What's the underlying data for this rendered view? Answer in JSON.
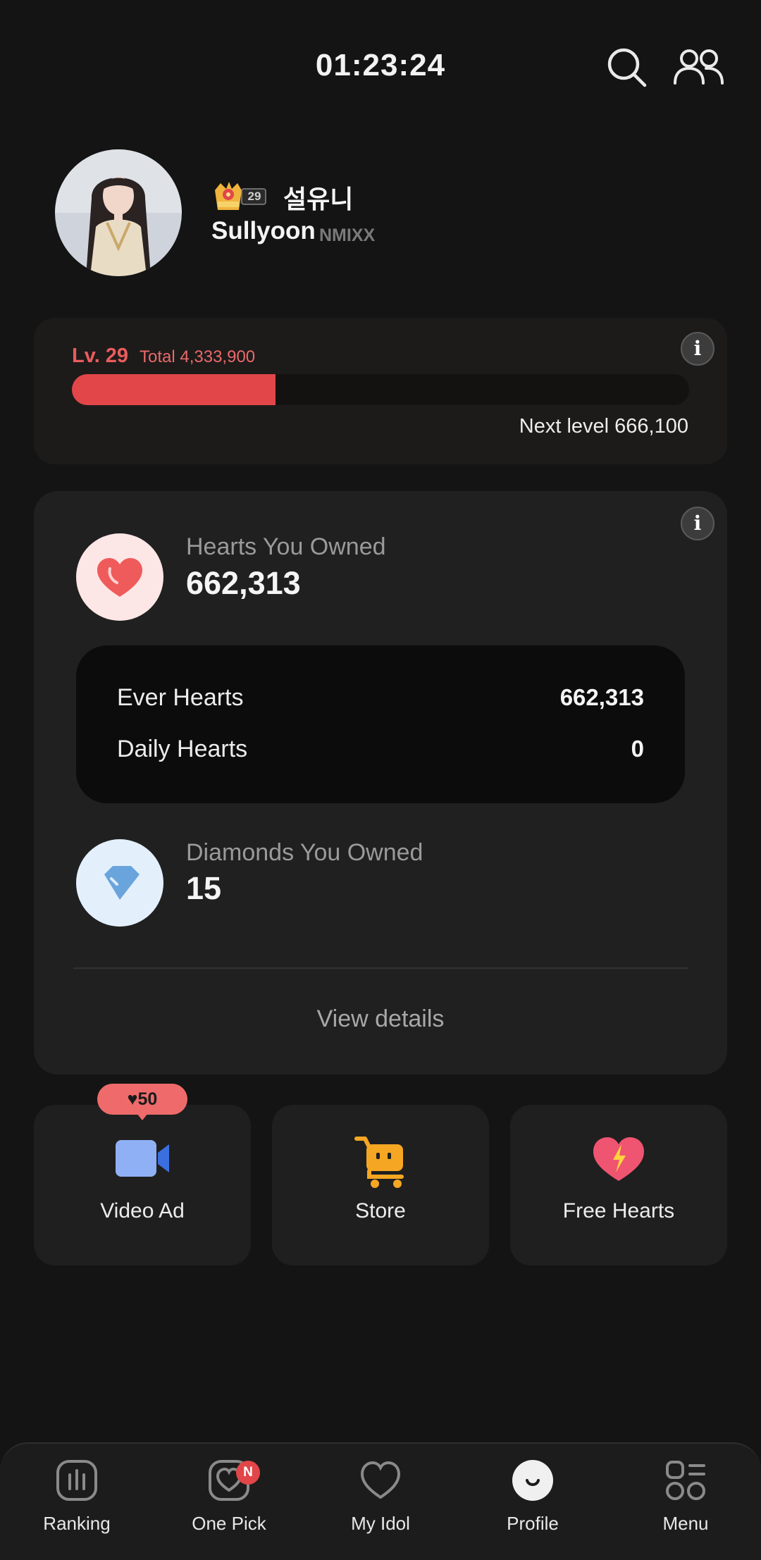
{
  "status": {
    "time": "01:23:24"
  },
  "profile": {
    "level_badge": "29",
    "korean_name": "설유니",
    "english_name": "Sullyoon",
    "group": "NMIXX"
  },
  "level_card": {
    "level": "Lv. 29",
    "total": "Total 4,333,900",
    "next_level": "Next level 666,100",
    "progress_fraction": 0.33,
    "info": "i"
  },
  "wallet": {
    "info": "i",
    "hearts_label": "Hearts You Owned",
    "hearts_value": "662,313",
    "rows": [
      {
        "label": "Ever Hearts",
        "value": "662,313"
      },
      {
        "label": "Daily Hearts",
        "value": "0"
      }
    ],
    "diamonds_label": "Diamonds You Owned",
    "diamonds_value": "15",
    "view_details": "View details"
  },
  "quick_actions": {
    "reward": "♥50",
    "video_ad": "Video Ad",
    "store": "Store",
    "free_hearts": "Free Hearts"
  },
  "nav": {
    "ranking": "Ranking",
    "one_pick": "One Pick",
    "one_pick_badge": "N",
    "my_idol": "My Idol",
    "profile": "Profile",
    "menu": "Menu"
  },
  "colors": {
    "background": "#141414",
    "accent_red": "#e24649",
    "card": "#202020",
    "video_icon_blue": "#8fb0f5",
    "store_icon_orange": "#f5a623",
    "free_hearts_pink": "#ef5470"
  }
}
